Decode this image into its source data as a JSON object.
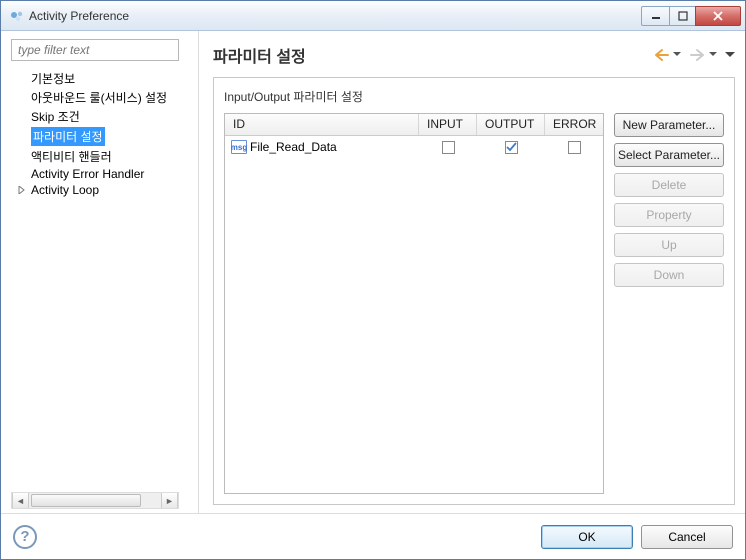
{
  "window": {
    "title": "Activity Preference"
  },
  "sidebar": {
    "filter_placeholder": "type filter text",
    "items": [
      {
        "label": "기본정보"
      },
      {
        "label": "아웃바운드 룰(서비스) 설정"
      },
      {
        "label": "Skip 조건"
      },
      {
        "label": "파라미터 설정"
      },
      {
        "label": "액티비티 핸들러"
      },
      {
        "label": "Activity Error Handler"
      },
      {
        "label": "Activity Loop",
        "hasArrow": true
      }
    ]
  },
  "main": {
    "title": "파라미터 설정",
    "subtitle": "Input/Output 파라미터 설정",
    "columns": {
      "id": "ID",
      "input": "INPUT",
      "output": "OUTPUT",
      "error": "ERROR"
    },
    "rows": [
      {
        "icon": "msg",
        "id": "File_Read_Data",
        "input": false,
        "output": true,
        "error": false
      }
    ],
    "buttons": {
      "new": "New Parameter...",
      "select": "Select Parameter...",
      "delete": "Delete",
      "property": "Property",
      "up": "Up",
      "down": "Down"
    }
  },
  "footer": {
    "ok": "OK",
    "cancel": "Cancel"
  }
}
